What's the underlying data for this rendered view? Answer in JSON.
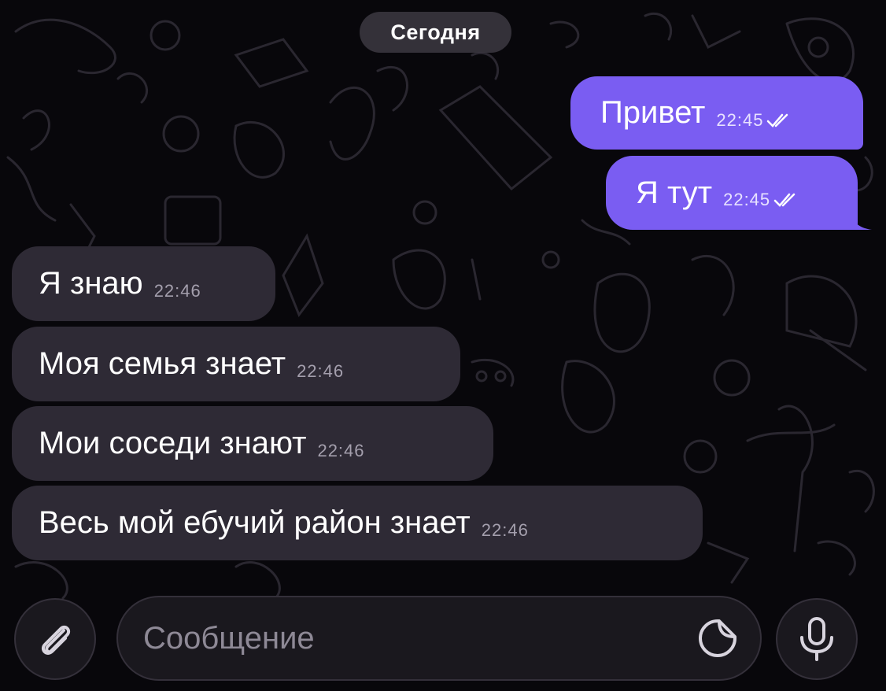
{
  "chat": {
    "date_label": "Сегодня",
    "messages": [
      {
        "direction": "outgoing",
        "text": "Привет",
        "time": "22:45",
        "status": "read"
      },
      {
        "direction": "outgoing",
        "text": "Я тут",
        "time": "22:45",
        "status": "read"
      },
      {
        "direction": "incoming",
        "text": "Я знаю",
        "time": "22:46"
      },
      {
        "direction": "incoming",
        "text": "Моя семья знает",
        "time": "22:46"
      },
      {
        "direction": "incoming",
        "text": "Мои соседи знают",
        "time": "22:46"
      },
      {
        "direction": "incoming",
        "text": "Весь мой ебучий район знает",
        "time": "22:46"
      }
    ]
  },
  "composer": {
    "placeholder": "Сообщение",
    "attach_icon": "paperclip-icon",
    "sticker_icon": "sticker-icon",
    "mic_icon": "microphone-icon"
  },
  "colors": {
    "background": "#08070b",
    "outgoing_bubble": "#7a5df2",
    "incoming_bubble": "#2e2a35",
    "date_pill": "#3c3842"
  }
}
